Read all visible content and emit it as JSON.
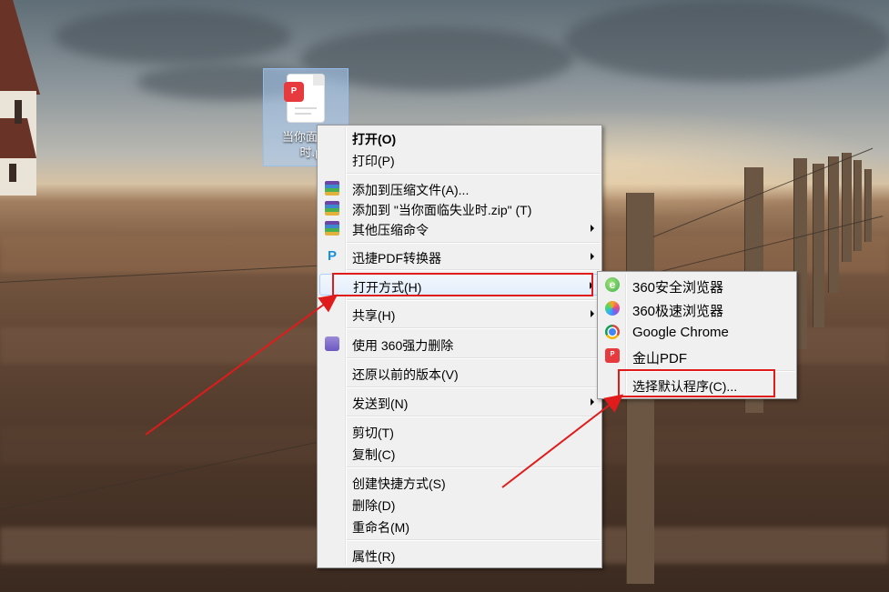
{
  "desktop": {
    "file_icon": {
      "name_line1": "当你面临",
      "name_line2": "时.pd",
      "badge": "ᴾ"
    }
  },
  "context_menu": {
    "items": [
      {
        "label": "打开(O)"
      },
      {
        "label": "打印(P)"
      },
      {
        "label": "添加到压缩文件(A)..."
      },
      {
        "label": "添加到 \"当你面临失业时.zip\" (T)"
      },
      {
        "label": "其他压缩命令"
      },
      {
        "label": "迅捷PDF转换器"
      },
      {
        "label": "打开方式(H)"
      },
      {
        "label": "共享(H)"
      },
      {
        "label": "使用 360强力删除"
      },
      {
        "label": "还原以前的版本(V)"
      },
      {
        "label": "发送到(N)"
      },
      {
        "label": "剪切(T)"
      },
      {
        "label": "复制(C)"
      },
      {
        "label": "创建快捷方式(S)"
      },
      {
        "label": "删除(D)"
      },
      {
        "label": "重命名(M)"
      },
      {
        "label": "属性(R)"
      }
    ]
  },
  "submenu": {
    "items": [
      {
        "label": "360安全浏览器",
        "icon": "360-browser-icon"
      },
      {
        "label": "360极速浏览器",
        "icon": "360-speed-browser-icon"
      },
      {
        "label": "Google Chrome",
        "icon": "chrome-icon"
      },
      {
        "label": "金山PDF",
        "icon": "kingsoft-pdf-icon"
      },
      {
        "label": "选择默认程序(C)..."
      }
    ]
  },
  "colors": {
    "annotation": "#e01b1b",
    "menu_bg": "#f0f0f0",
    "highlight_border": "#aecff7"
  }
}
